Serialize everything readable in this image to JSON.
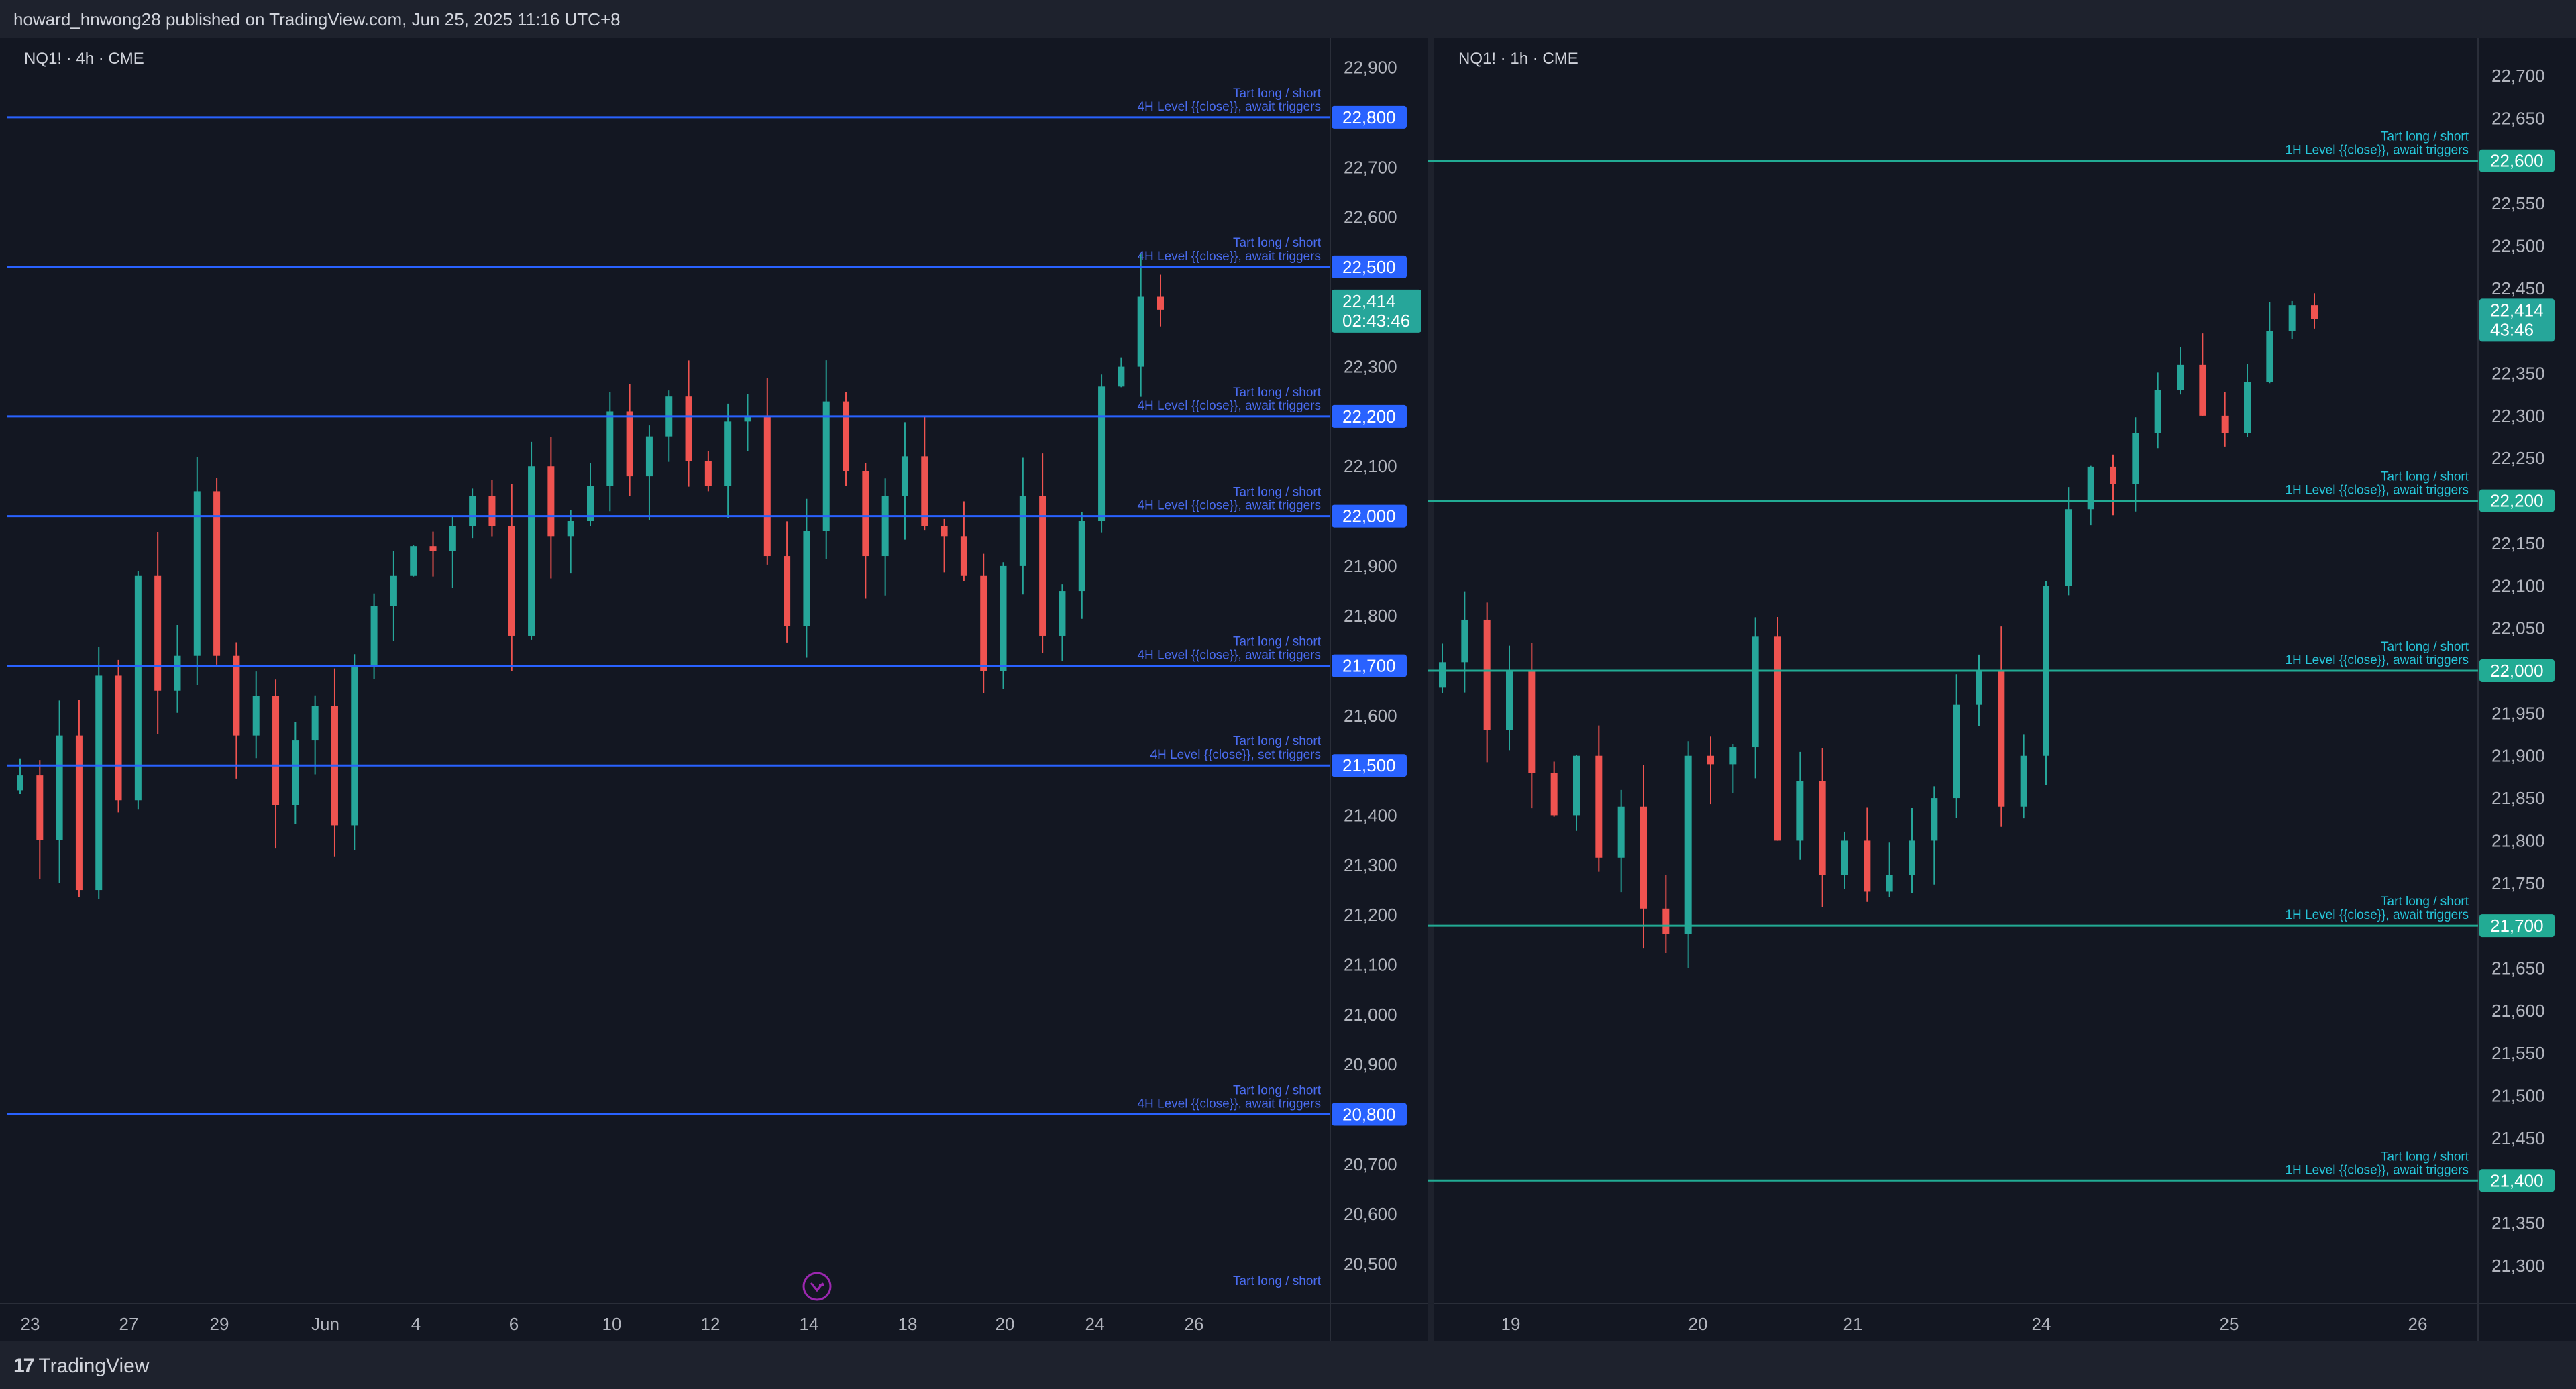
{
  "header": {
    "published_text": "howard_hnwong28 published on TradingView.com, Jun 25, 2025 11:16 UTC+8"
  },
  "footer": {
    "brand": "TradingView",
    "logo_icon": "tradingview-logo-icon"
  },
  "colors": {
    "background": "#131722",
    "up": "#26a69a",
    "down": "#ef5350",
    "left_level": "#2962ff",
    "right_level": "#22ab94"
  },
  "chart_data": [
    {
      "type": "candlestick",
      "symbol_label": "NQ1! · 4h · CME",
      "ylim": [
        20420,
        22960
      ],
      "y_ticks": [
        20500,
        20600,
        20700,
        20800,
        20900,
        21000,
        21100,
        21200,
        21300,
        21400,
        21500,
        21600,
        21700,
        21800,
        21900,
        22000,
        22100,
        22200,
        22300,
        22400,
        22500,
        22600,
        22700,
        22800,
        22900
      ],
      "x_labels": [
        "23",
        "27",
        "29",
        "Jun",
        "4",
        "6",
        "10",
        "12",
        "14",
        "18",
        "20",
        "24",
        "26"
      ],
      "last_price": "22,414",
      "countdown": "02:43:46",
      "levels": [
        {
          "price": 22800,
          "label": "22,800",
          "note1": "Tart long / short",
          "note2": "4H Level {{close}}, await triggers"
        },
        {
          "price": 22500,
          "label": "22,500",
          "note1": "Tart long / short",
          "note2": "4H Level {{close}}, await triggers"
        },
        {
          "price": 22200,
          "label": "22,200",
          "note1": "Tart long / short",
          "note2": "4H Level {{close}}, await triggers"
        },
        {
          "price": 22000,
          "label": "22,000",
          "note1": "Tart long / short",
          "note2": "4H Level {{close}}, await triggers"
        },
        {
          "price": 21700,
          "label": "21,700",
          "note1": "Tart long / short",
          "note2": "4H Level {{close}}, await triggers"
        },
        {
          "price": 21500,
          "label": "21,500",
          "note1": "Tart long / short",
          "note2": "4H Level {{close}}, set triggers"
        },
        {
          "price": 20800,
          "label": "20,800",
          "note1": "Tart long / short",
          "note2": "4H Level {{close}}, await triggers"
        }
      ],
      "bottom_note": "Tart long / short",
      "marker_icon": "replay-arrow-icon",
      "path": [
        21480,
        21350,
        21560,
        21250,
        21680,
        21430,
        21880,
        21650,
        21720,
        22050,
        21720,
        21560,
        21640,
        21420,
        21550,
        21620,
        21380,
        21700,
        21820,
        21880,
        21940,
        21930,
        21980,
        22040,
        21980,
        21760,
        22100,
        21960,
        21990,
        22060,
        22210,
        22080,
        22160,
        22240,
        22110,
        22060,
        22190,
        22200,
        21920,
        21780,
        21970,
        22230,
        22090,
        21920,
        22040,
        22120,
        21980,
        21960,
        21880,
        21690,
        21900,
        22040,
        21760,
        21850,
        21990,
        22260,
        22300,
        22440,
        22414
      ]
    },
    {
      "type": "candlestick",
      "symbol_label": "NQ1! · 1h · CME",
      "ylim": [
        21255,
        22745
      ],
      "y_ticks": [
        21300,
        21350,
        21400,
        21450,
        21500,
        21550,
        21600,
        21650,
        21700,
        21750,
        21800,
        21850,
        21900,
        21950,
        22000,
        22050,
        22100,
        22150,
        22200,
        22250,
        22300,
        22350,
        22400,
        22450,
        22500,
        22550,
        22600,
        22650,
        22700
      ],
      "x_labels": [
        "19",
        "20",
        "21",
        "24",
        "25",
        "26"
      ],
      "last_price": "22,414",
      "countdown": "43:46",
      "levels": [
        {
          "price": 22600,
          "label": "22,600",
          "note1": "Tart long / short",
          "note2": "1H Level {{close}}, await triggers"
        },
        {
          "price": 22200,
          "label": "22,200",
          "note1": "Tart long / short",
          "note2": "1H Level {{close}}, await triggers"
        },
        {
          "price": 22000,
          "label": "22,000",
          "note1": "Tart long / short",
          "note2": "1H Level {{close}}, await triggers"
        },
        {
          "price": 21700,
          "label": "21,700",
          "note1": "Tart long / short",
          "note2": "1H Level {{close}}, await triggers"
        },
        {
          "price": 21400,
          "label": "21,400",
          "note1": "Tart long / short",
          "note2": "1H Level {{close}}, await triggers"
        }
      ],
      "path": [
        22010,
        22060,
        21930,
        22000,
        21880,
        21830,
        21900,
        21780,
        21840,
        21720,
        21690,
        21900,
        21890,
        21910,
        22040,
        21800,
        21870,
        21760,
        21800,
        21740,
        21760,
        21800,
        21850,
        21960,
        22000,
        21840,
        21900,
        22100,
        22190,
        22240,
        22220,
        22280,
        22330,
        22360,
        22300,
        22280,
        22340,
        22400,
        22430,
        22414
      ]
    }
  ]
}
